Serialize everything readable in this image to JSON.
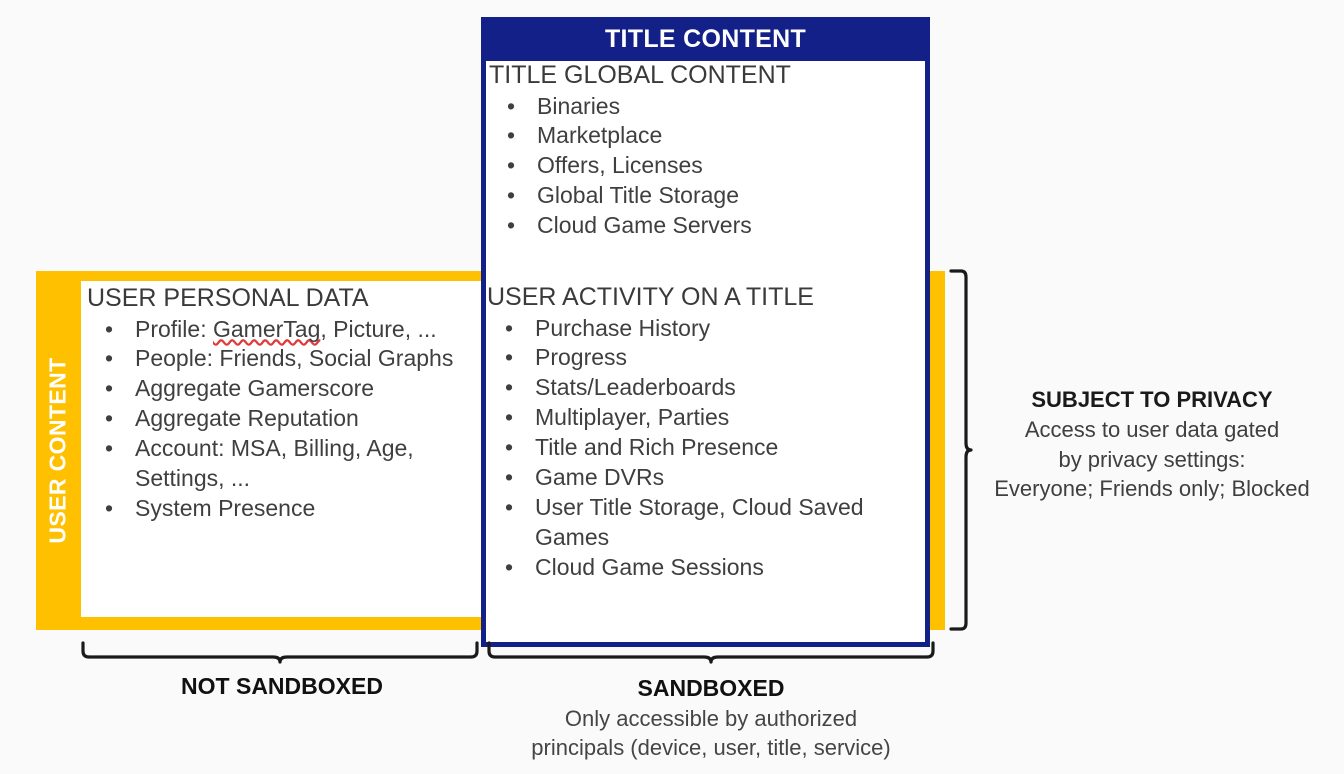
{
  "diagram": {
    "background_color": "#fafafa",
    "accent_yellow": "#ffc000",
    "accent_blue": "#122087"
  },
  "title_content": {
    "header_label": "TITLE CONTENT",
    "global": {
      "heading": "TITLE GLOBAL CONTENT",
      "bullet_char": "•",
      "items": [
        "Binaries",
        "Marketplace",
        "Offers, Licenses",
        "Global Title Storage",
        "Cloud Game Servers"
      ]
    },
    "activity": {
      "heading": "USER ACTIVITY ON A TITLE",
      "bullet_char": "•",
      "items": [
        "Purchase History",
        "Progress",
        "Stats/Leaderboards",
        "Multiplayer, Parties",
        "Title and Rich Presence",
        "Game DVRs",
        "User Title Storage, Cloud Saved Games",
        "Cloud Game Sessions"
      ]
    }
  },
  "user_content": {
    "side_label": "USER CONTENT",
    "personal": {
      "heading": "USER PERSONAL DATA",
      "bullet_char": "•",
      "items": [
        {
          "prefix": "Profile: ",
          "misspelled": "GamerTag",
          "suffix": ", Picture, ..."
        },
        {
          "prefix": "People: Friends, Social Graphs",
          "misspelled": "",
          "suffix": ""
        },
        {
          "prefix": "Aggregate Gamerscore",
          "misspelled": "",
          "suffix": ""
        },
        {
          "prefix": "Aggregate Reputation",
          "misspelled": "",
          "suffix": ""
        },
        {
          "prefix": "Account: MSA, Billing, Age, Settings, ...",
          "misspelled": "",
          "suffix": ""
        },
        {
          "prefix": "System Presence",
          "misspelled": "",
          "suffix": ""
        }
      ]
    }
  },
  "privacy_note": {
    "title": "SUBJECT TO PRIVACY",
    "line1": "Access to user data gated",
    "line2": "by privacy settings:",
    "line3": "Everyone; Friends only; Blocked"
  },
  "captions": {
    "not_sandboxed": {
      "title": "NOT SANDBOXED",
      "sub1": "",
      "sub2": ""
    },
    "sandboxed": {
      "title": "SANDBOXED",
      "sub1": "Only accessible by authorized",
      "sub2": "principals (device, user, title, service)"
    }
  }
}
